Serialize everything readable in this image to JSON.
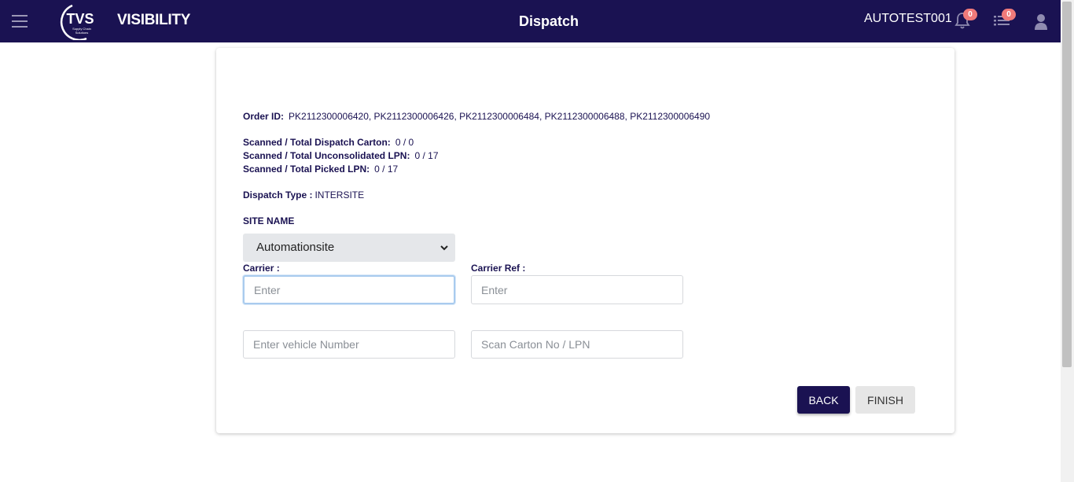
{
  "header": {
    "brand_logo_text": "TVS",
    "brand_logo_subtext": "Supply Chain Solutions",
    "brand_name": "VISIBILITY",
    "page_title": "Dispatch",
    "username": "AUTOTEST001",
    "notifications_count": "0",
    "tasks_count": "0",
    "icons": [
      "hamburger-menu-icon",
      "bell-icon",
      "list-icon",
      "user-icon"
    ]
  },
  "dispatch": {
    "order_id_label": "Order ID:",
    "order_id_value": "PK2112300006420, PK2112300006426, PK2112300006484, PK2112300006488, PK2112300006490",
    "carton_label": "Scanned / Total Dispatch Carton:",
    "carton_value": "0 / 0",
    "unconsolidated_label": "Scanned / Total Unconsolidated LPN:",
    "unconsolidated_value": "0 / 17",
    "picked_label": "Scanned / Total Picked LPN:",
    "picked_value": "0 / 17",
    "dispatch_type_label": "Dispatch Type :",
    "dispatch_type_value": "INTERSITE",
    "site_name_label": "SITE NAME",
    "site_name_selected": "Automationsite",
    "carrier_label": "Carrier :",
    "carrier_placeholder": "Enter",
    "carrier_ref_label": "Carrier Ref :",
    "carrier_ref_placeholder": "Enter",
    "vehicle_placeholder": "Enter vehicle Number",
    "scan_placeholder": "Scan Carton No / LPN",
    "back_label": "BACK",
    "finish_label": "FINISH"
  },
  "colors": {
    "header_bg": "#1a1252",
    "primary_button": "#1a1252",
    "badge": "#f07a7a",
    "select_bg": "#e5e7ea"
  }
}
